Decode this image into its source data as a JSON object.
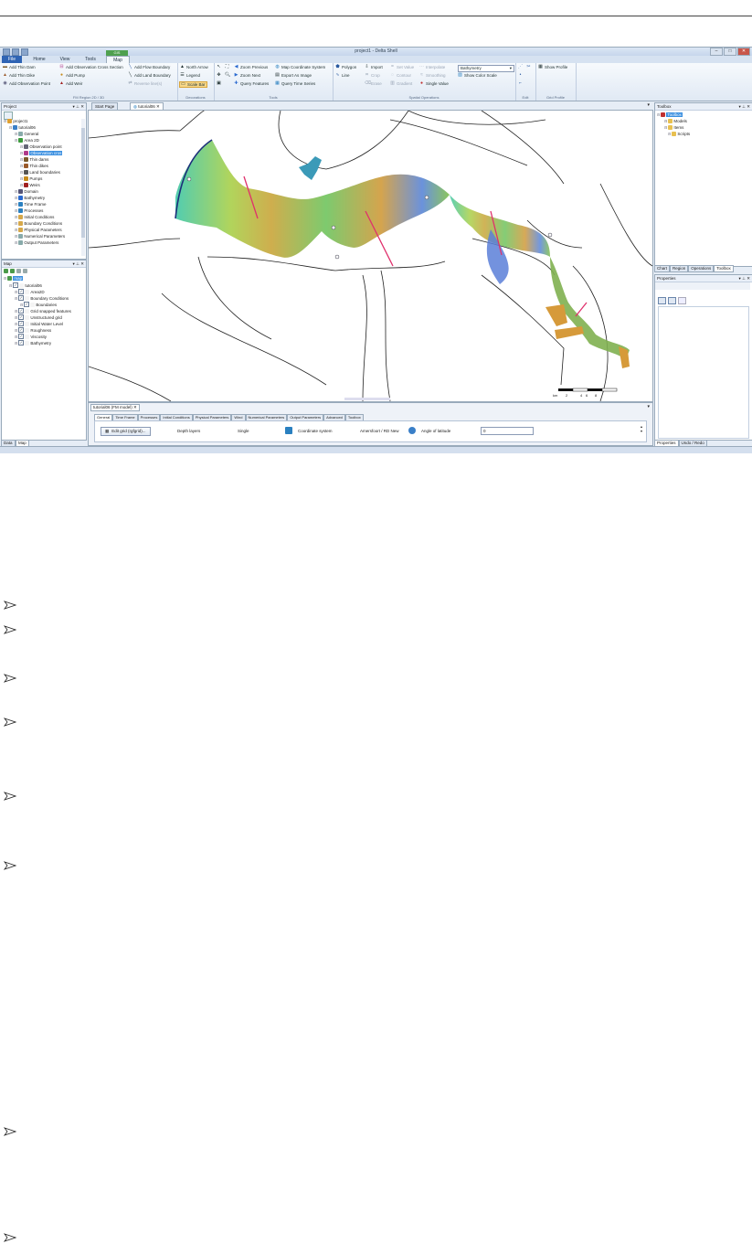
{
  "window": {
    "title": "project1 - Delta Shell",
    "controls": [
      "–",
      "□",
      "✕"
    ],
    "contextual_tab": "GIS"
  },
  "ribbon_tabs": [
    "File",
    "Home",
    "View",
    "Tools",
    "Map"
  ],
  "ribbon": {
    "fm_region": {
      "label": "FM Region 2D / 3D",
      "items": [
        "Add Thin Dam",
        "Add Thin Dike",
        "Add Observation Point",
        "Add Observation Cross Section",
        "Add Pump",
        "Add Weir",
        "Add Flow Boundary",
        "Add Land Boundary",
        "Reverse line(s)"
      ]
    },
    "decorations": {
      "label": "Decorations",
      "items": [
        "North Arrow",
        "Legend",
        "Scale Bar"
      ]
    },
    "tools": {
      "label": "Tools",
      "items": [
        "Zoom Previous",
        "Zoom Next",
        "Query Features",
        "Map Coordinate System",
        "Export As Image",
        "Query Time Series"
      ]
    },
    "spatial": {
      "label": "Spatial Operations",
      "items": [
        "Polygon",
        "Line",
        "Import",
        "Crop",
        "Erase",
        "Set Value",
        "Contour",
        "Gradient",
        "Interpolate",
        "Smoothing",
        "Single Value",
        "Show Color Scale"
      ],
      "layer_select": "Bathymetry"
    },
    "edit": {
      "label": "Edit"
    },
    "grid_profile": {
      "label": "Grid Profile",
      "items": [
        "Show Profile"
      ]
    }
  },
  "project_panel": {
    "title": "Project",
    "nodes": [
      "project1",
      "tutorial06",
      "General",
      "Area 2D",
      "Observation point",
      "Observation cros",
      "Thin dams",
      "Thin dikes",
      "Land boundaries",
      "Pumps",
      "Weirs",
      "Domain",
      "Bathymetry",
      "Time Frame",
      "Processes",
      "Initial Conditions",
      "Boundary Conditions",
      "Physical Parameters",
      "Numerical Parameters",
      "Output Parameters"
    ]
  },
  "map_panel": {
    "title": "Map",
    "nodes": [
      "map",
      "tutorial06",
      "Area2D",
      "Boundary Conditions",
      "Boundaries",
      "Grid snapped features",
      "Unstructured grid",
      "Initial Water Level",
      "Roughness",
      "Viscosity",
      "Bathymetry"
    ],
    "tabs": [
      "Data",
      "Map"
    ]
  },
  "document_tabs": [
    "Start Page",
    "tutorial06"
  ],
  "scale_bar": {
    "unit": "km",
    "ticks": [
      "0",
      "2",
      "4",
      "6",
      "8"
    ]
  },
  "model_editor": {
    "title": "tutorial06 (FM model)",
    "tabs": [
      "General",
      "Time Frame",
      "Processes",
      "Initial Conditions",
      "Physical Parameters",
      "Wind",
      "Numerical Parameters",
      "Output Parameters",
      "Advanced",
      "Toolbox"
    ],
    "edit_grid_button": "Edit grid (rgfgrid)...",
    "depth_layers_label": "Depth layers",
    "depth_layers_value": "Single",
    "coord_label": "Coordinate system",
    "coord_value": "Amersfoort / RD New",
    "latitude_label": "Angle of latitude",
    "latitude_value": "0"
  },
  "toolbox_panel": {
    "title": "Toolbox",
    "nodes": [
      "Toolbox",
      "Models",
      "Items",
      "Scripts"
    ],
    "tabs": [
      "Chart",
      "Region",
      "Operations",
      "Toolbox"
    ]
  },
  "properties_panel": {
    "title": "Properties",
    "tabs": [
      "Properties",
      "Undo / Redo"
    ]
  }
}
